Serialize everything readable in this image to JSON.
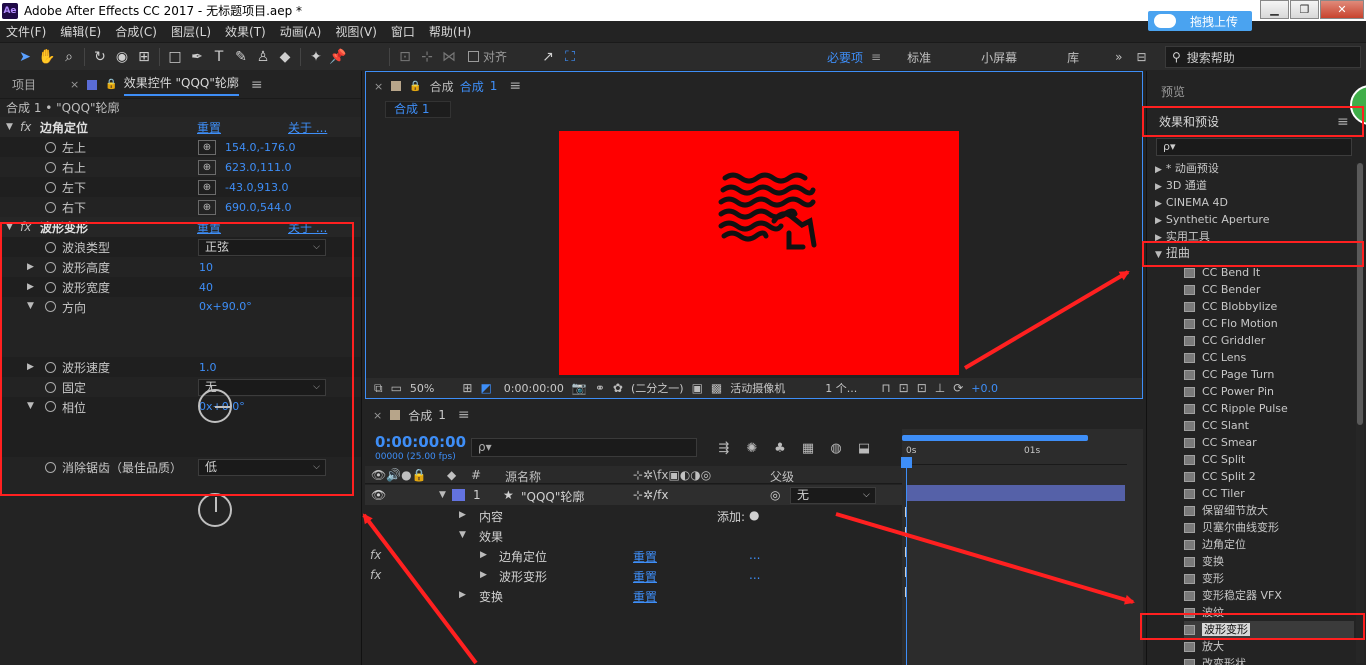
{
  "window": {
    "title": "Adobe After Effects CC 2017 - 无标题项目.aep *",
    "logo": "Ae",
    "cloud_button": "拖拽上传",
    "controls": [
      "minimize-icon",
      "maximize-icon",
      "close-icon"
    ]
  },
  "menu": [
    "文件(F)",
    "编辑(E)",
    "合成(C)",
    "图层(L)",
    "效果(T)",
    "动画(A)",
    "视图(V)",
    "窗口",
    "帮助(H)"
  ],
  "toolbar": {
    "tools": [
      "selection-icon",
      "hand-icon",
      "zoom-icon",
      "rotate-icon",
      "camera-icon",
      "pan-behind-icon",
      "rectangle-icon",
      "pen-icon",
      "type-icon",
      "brush-icon",
      "stamp-icon",
      "eraser-icon",
      "roto-brush-icon",
      "puppet-pin-icon"
    ],
    "snap_label": "对齐",
    "workspaces": [
      "必要项",
      "标准",
      "小屏幕",
      "库"
    ],
    "help_search_placeholder": "搜索帮助"
  },
  "left_panel": {
    "tab_project": "项目",
    "tab_effects": "效果控件 \"QQQ\"轮廓",
    "subtitle": "合成 1 • \"QQQ\"轮廓",
    "corner_pin": {
      "name": "边角定位",
      "reset": "重置",
      "about": "关于 ...",
      "params": [
        {
          "name": "左上",
          "value": "154.0,-176.0"
        },
        {
          "name": "右上",
          "value": "623.0,111.0"
        },
        {
          "name": "左下",
          "value": "-43.0,913.0"
        },
        {
          "name": "右下",
          "value": "690.0,544.0"
        }
      ]
    },
    "wave_warp": {
      "name": "波形变形",
      "reset": "重置",
      "about": "关于 ...",
      "wave_type_label": "波浪类型",
      "wave_type_value": "正弦",
      "wave_height_label": "波形高度",
      "wave_height_value": "10",
      "wave_width_label": "波形宽度",
      "wave_width_value": "40",
      "direction_label": "方向",
      "direction_value": "0x+90.0°",
      "wave_speed_label": "波形速度",
      "wave_speed_value": "1.0",
      "pinning_label": "固定",
      "pinning_value": "无",
      "phase_label": "相位",
      "phase_value": "0x+0.0°",
      "antialias_label": "消除锯齿（最佳品质）",
      "antialias_value": "低"
    }
  },
  "comp_viewer": {
    "tab_prefix": "合成",
    "tab_name": "合成",
    "tab_num": "1",
    "subtab": "合成 1",
    "zoom": "50%",
    "timecode": "0:00:00:00",
    "resolution": "(二分之一)",
    "camera": "活动摄像机",
    "views": "1 个...",
    "exposure": "+0.0",
    "canvas_color": "#ff0000"
  },
  "timeline": {
    "tab_name": "合成",
    "tab_num": "1",
    "timecode": "0:00:00:00",
    "fps": "00000 (25.00 fps)",
    "search_placeholder": "ρ▾",
    "col_hash": "#",
    "col_source": "源名称",
    "col_parent": "父级",
    "layer_num": "1",
    "layer_name": "\"QQQ\"轮廓",
    "parent_value": "无",
    "contents_label": "内容",
    "add_label": "添加:",
    "effects_label": "效果",
    "corner_pin_label": "边角定位",
    "wave_warp_label": "波形变形",
    "transform_label": "变换",
    "reset": "重置",
    "dots": "...",
    "ruler_0": "0s",
    "ruler_1": "01s"
  },
  "right_panel": {
    "preview": "预览",
    "title": "效果和预设",
    "search_placeholder": "ρ▾",
    "categories": [
      "* 动画预设",
      "3D 通道",
      "CINEMA 4D",
      "Synthetic Aperture",
      "实用工具"
    ],
    "distort": "扭曲",
    "distort_items": [
      "CC Bend It",
      "CC Bender",
      "CC Blobbylize",
      "CC Flo Motion",
      "CC Griddler",
      "CC Lens",
      "CC Page Turn",
      "CC Power Pin",
      "CC Ripple Pulse",
      "CC Slant",
      "CC Smear",
      "CC Split",
      "CC Split 2",
      "CC Tiler",
      "保留细节放大",
      "贝塞尔曲线变形",
      "边角定位",
      "变换",
      "变形",
      "变形稳定器 VFX",
      "波纹",
      "波形变形",
      "放大",
      "改变形状"
    ]
  }
}
